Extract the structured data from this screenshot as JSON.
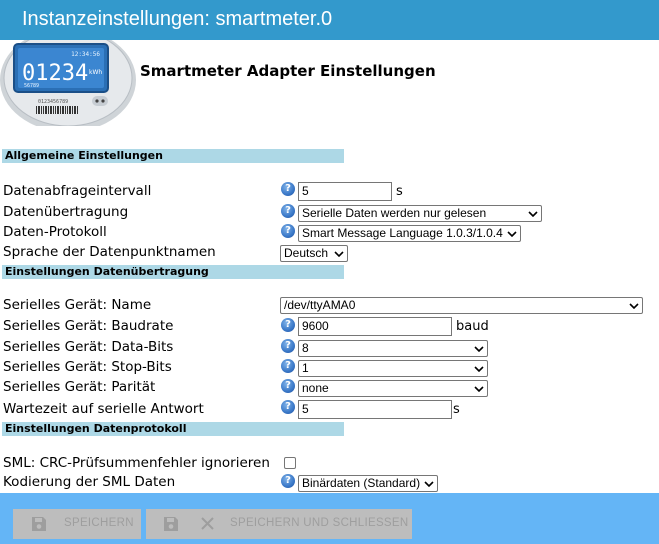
{
  "window": {
    "title": "Instanzeinstellungen: smartmeter.0"
  },
  "logo": {
    "display_value": "01234",
    "unit": "kWh",
    "time": "12:34:56",
    "small_number": "56789",
    "serial": "0123456789"
  },
  "heading": "Smartmeter Adapter Einstellungen",
  "sections": {
    "general": "Allgemeine Einstellungen",
    "transfer": "Einstellungen Datenübertragung",
    "protocol": "Einstellungen Datenprotokoll"
  },
  "general": {
    "interval": {
      "label": "Datenabfrageintervall",
      "value": "5",
      "unit": "s"
    },
    "transfer": {
      "label": "Datenübertragung",
      "value": "Serielle Daten werden nur gelesen"
    },
    "protocol": {
      "label": "Daten-Protokoll",
      "value": "Smart Message Language 1.0.3/1.0.4"
    },
    "language": {
      "label": "Sprache der Datenpunktnamen",
      "value": "Deutsch"
    }
  },
  "serial": {
    "device": {
      "label": "Serielles Gerät: Name",
      "value": "/dev/ttyAMA0"
    },
    "baudrate": {
      "label": "Serielles Gerät: Baudrate",
      "value": "9600",
      "unit": "baud"
    },
    "databits": {
      "label": "Serielles Gerät: Data-Bits",
      "value": "8"
    },
    "stopbits": {
      "label": "Serielles Gerät: Stop-Bits",
      "value": "1"
    },
    "parity": {
      "label": "Serielles Gerät: Parität",
      "value": "none"
    },
    "timeout": {
      "label": "Wartezeit auf serielle Antwort",
      "value": "5",
      "unit": "s"
    }
  },
  "protocol_settings": {
    "crc": {
      "label": "SML: CRC-Prüfsummenfehler ignorieren",
      "checked": false
    },
    "encoding": {
      "label": "Kodierung der SML Daten",
      "value": "Binärdaten (Standard)"
    }
  },
  "footer": {
    "save_label": "SPEICHERN",
    "save_close_label": "SPEICHERN UND SCHLIESSEN"
  },
  "colors": {
    "titlebar": "#3399cc",
    "section": "#add8e6",
    "footer": "#64b5f6",
    "button": "#bdbdbd",
    "button_text": "#9e9e9e"
  }
}
